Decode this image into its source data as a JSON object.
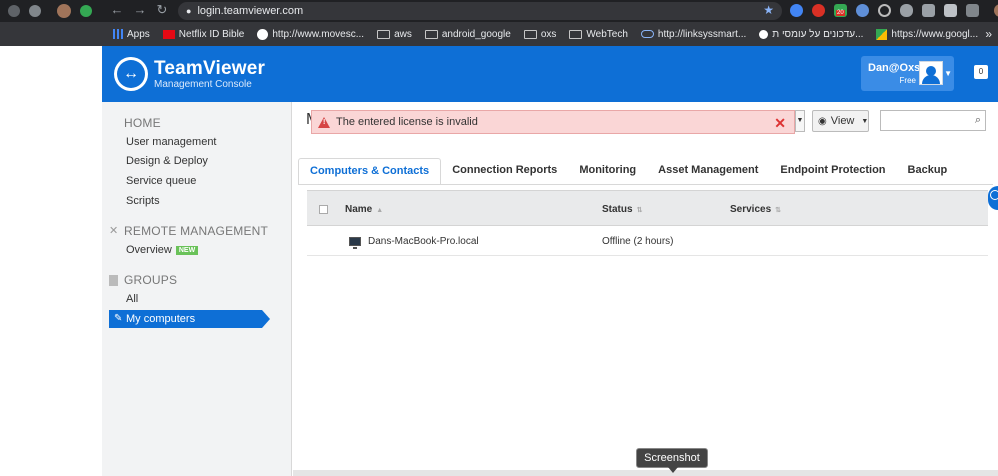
{
  "browser": {
    "url": "login.teamviewer.com",
    "bookmarks": [
      {
        "label": "Apps",
        "icon": "apps-grid-icon"
      },
      {
        "label": "Netflix ID Bible",
        "icon": "netflix-icon"
      },
      {
        "label": "http://www.movesc...",
        "icon": "site-icon"
      },
      {
        "label": "aws",
        "icon": "folder-icon"
      },
      {
        "label": "android_google",
        "icon": "folder-icon"
      },
      {
        "label": "oxs",
        "icon": "folder-icon"
      },
      {
        "label": "WebTech",
        "icon": "folder-icon"
      },
      {
        "label": "http://linksyssmart...",
        "icon": "linksys-icon"
      },
      {
        "label": "עדכונים על עומסי ת...",
        "icon": "site-icon"
      },
      {
        "label": "https://www.googl...",
        "icon": "google-maps-icon"
      }
    ],
    "more": "»",
    "ext_badge": "20"
  },
  "header": {
    "brand": "TeamViewer",
    "subtitle": "Management Console",
    "user_name": "Dan@Oxs",
    "user_plan": "Free",
    "notif_count": "0"
  },
  "sidebar": {
    "home_heading": "HOME",
    "home_items": [
      "User management",
      "Design & Deploy",
      "Service queue",
      "Scripts"
    ],
    "remote_heading": "REMOTE MANAGEMENT",
    "overview_label": "Overview",
    "new_badge": "NEW",
    "groups_heading": "GROUPS",
    "groups_items": [
      "All",
      "My computers"
    ]
  },
  "alert": {
    "message": "The entered license is invalid"
  },
  "toolbar": {
    "view_label": "View",
    "search_placeholder": ""
  },
  "tabs": [
    "Computers & Contacts",
    "Connection Reports",
    "Monitoring",
    "Asset Management",
    "Endpoint Protection",
    "Backup"
  ],
  "table": {
    "columns": [
      "Name",
      "Status",
      "Services"
    ],
    "rows": [
      {
        "name": "Dans-MacBook-Pro.local",
        "status": "Offline (2 hours)"
      }
    ]
  },
  "tooltip": "Screenshot",
  "colors": {
    "brand_blue": "#0e6fd6",
    "alert_bg": "#fad6d6",
    "new_badge": "#6ac259"
  }
}
